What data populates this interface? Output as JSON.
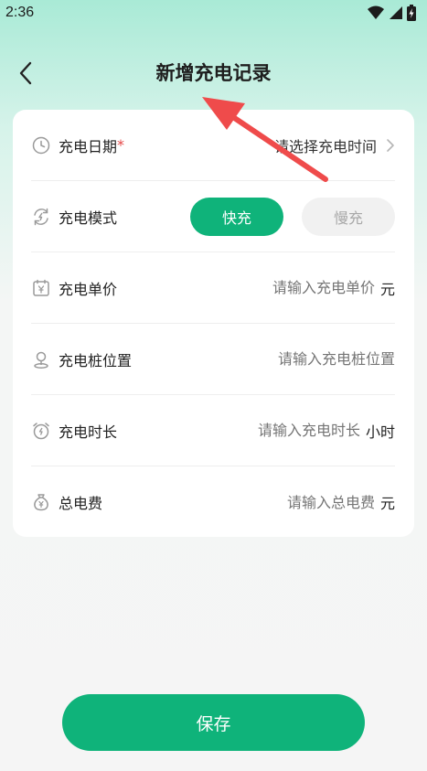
{
  "status_bar": {
    "time": "2:36",
    "icons": [
      "wifi-icon",
      "signal-icon",
      "battery-charging-icon"
    ]
  },
  "header": {
    "title": "新增充电记录",
    "back_icon": "chevron-left-icon"
  },
  "form": {
    "date": {
      "label": "充电日期",
      "required_mark": "*",
      "value": "请选择充电时间",
      "icon": "clock-icon"
    },
    "mode": {
      "label": "充电模式",
      "icon": "refresh-bolt-icon",
      "options": [
        "快充",
        "慢充"
      ],
      "selected": "快充"
    },
    "price": {
      "label": "充电单价",
      "placeholder": "请输入充电单价",
      "unit": "元",
      "icon": "calendar-yen-icon"
    },
    "location": {
      "label": "充电桩位置",
      "placeholder": "请输入充电桩位置",
      "icon": "location-pin-icon"
    },
    "duration": {
      "label": "充电时长",
      "placeholder": "请输入充电时长",
      "unit": "小时",
      "icon": "alarm-clock-icon"
    },
    "total": {
      "label": "总电费",
      "placeholder": "请输入总电费",
      "unit": "元",
      "icon": "money-bag-icon"
    }
  },
  "save_button": {
    "label": "保存"
  },
  "colors": {
    "primary": "#0fb37a",
    "annotation_arrow": "#ef4b4b",
    "required": "#e54848"
  }
}
